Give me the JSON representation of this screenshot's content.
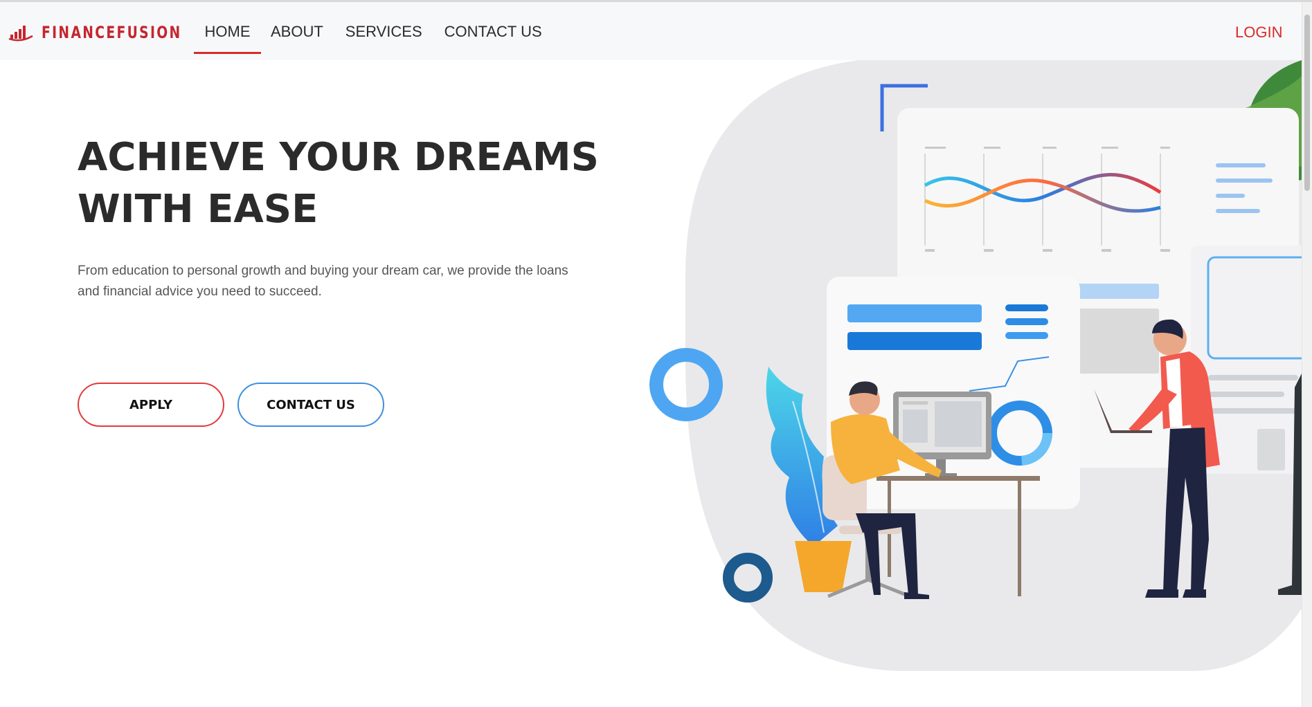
{
  "brand": {
    "name": "FINANCEFUSION",
    "logo_icon": "bar-chart-logo-icon"
  },
  "nav": {
    "items": [
      {
        "label": "HOME",
        "active": true
      },
      {
        "label": "ABOUT",
        "active": false
      },
      {
        "label": "SERVICES",
        "active": false
      },
      {
        "label": "CONTACT US",
        "active": false
      }
    ],
    "login_label": "LOGIN"
  },
  "hero": {
    "title_line1": "ACHIEVE YOUR DREAMS",
    "title_line2": "WITH EASE",
    "description": "From education to personal growth and buying your dream car, we provide the loans and financial advice you need to succeed.",
    "apply_label": "APPLY",
    "contact_label": "CONTACT US"
  },
  "colors": {
    "brand_red": "#c4262e",
    "accent_red": "#d92a2a",
    "accent_blue": "#3d8fe0",
    "text_dark": "#2b2b2b"
  }
}
